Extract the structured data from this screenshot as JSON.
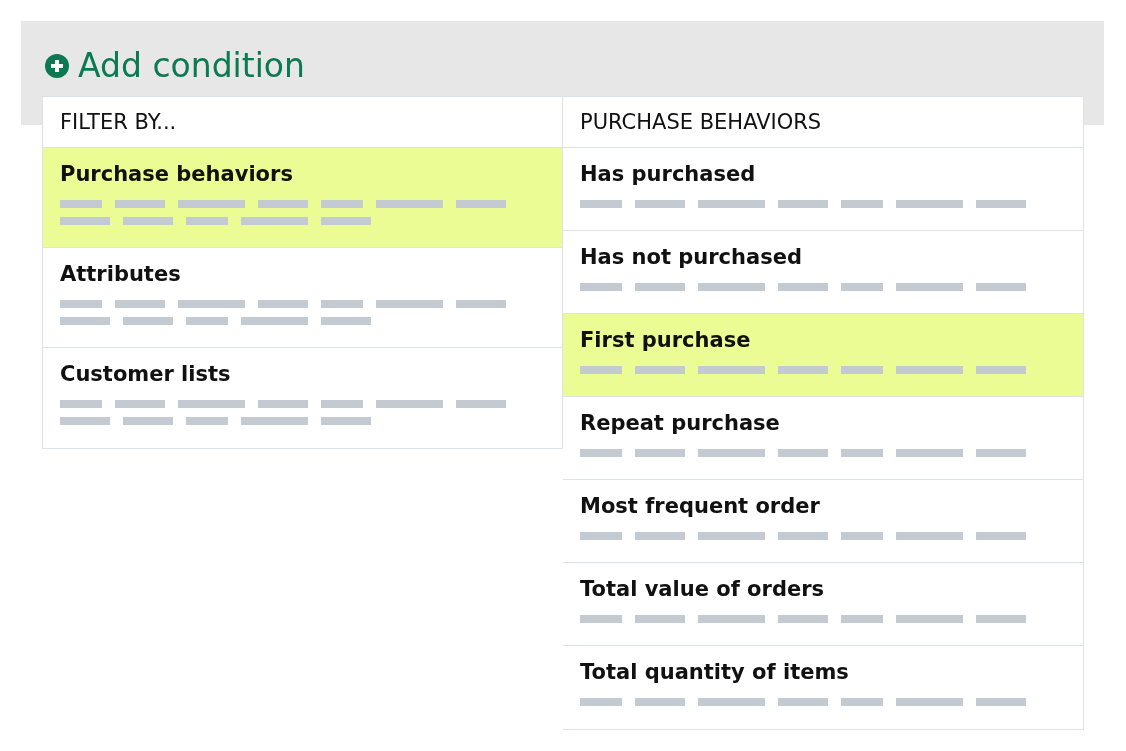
{
  "add_condition": {
    "label": "Add condition"
  },
  "filter_panel": {
    "header": "FILTER BY...",
    "items": [
      {
        "label": "Purchase behaviors",
        "selected": true
      },
      {
        "label": "Attributes",
        "selected": false
      },
      {
        "label": "Customer lists",
        "selected": false
      }
    ]
  },
  "options_panel": {
    "header": "PURCHASE BEHAVIORS",
    "items": [
      {
        "label": "Has purchased",
        "selected": false
      },
      {
        "label": "Has not purchased",
        "selected": false
      },
      {
        "label": "First purchase",
        "selected": true
      },
      {
        "label": "Repeat purchase",
        "selected": false
      },
      {
        "label": "Most frequent order",
        "selected": false
      },
      {
        "label": "Total value of orders",
        "selected": false
      },
      {
        "label": "Total quantity of items",
        "selected": false
      }
    ]
  }
}
